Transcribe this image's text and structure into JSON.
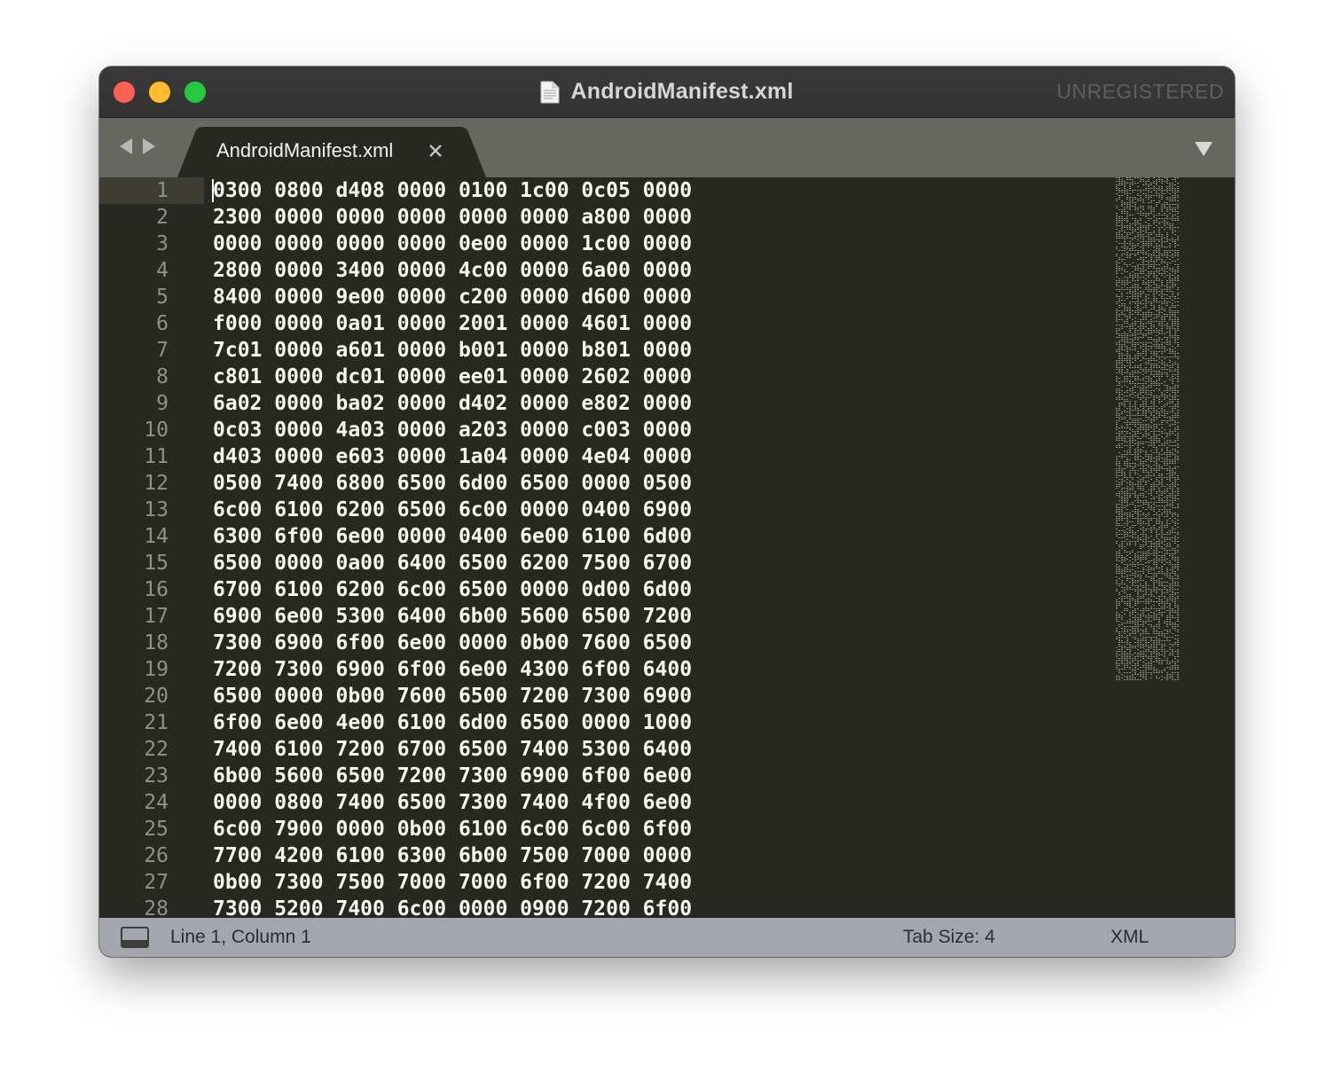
{
  "window": {
    "title": "AndroidManifest.xml",
    "unregistered_label": "UNREGISTERED"
  },
  "tabs": [
    {
      "label": "AndroidManifest.xml",
      "active": true
    }
  ],
  "icons": {
    "close": "close-icon",
    "document": "document-icon",
    "back": "arrow-left-icon",
    "forward": "arrow-right-icon",
    "dropdown": "dropdown-arrow-icon",
    "panel": "panel-icon"
  },
  "colors": {
    "editor_bg": "#272822",
    "text": "#f8f8f2",
    "gutter_text": "#90908a",
    "statusbar_bg": "#a4a6ad"
  },
  "editor": {
    "lines": [
      {
        "number": "1",
        "text": "0300 0800 d408 0000 0100 1c00 0c05 0000"
      },
      {
        "number": "2",
        "text": "2300 0000 0000 0000 0000 0000 a800 0000"
      },
      {
        "number": "3",
        "text": "0000 0000 0000 0000 0e00 0000 1c00 0000"
      },
      {
        "number": "4",
        "text": "2800 0000 3400 0000 4c00 0000 6a00 0000"
      },
      {
        "number": "5",
        "text": "8400 0000 9e00 0000 c200 0000 d600 0000"
      },
      {
        "number": "6",
        "text": "f000 0000 0a01 0000 2001 0000 4601 0000"
      },
      {
        "number": "7",
        "text": "7c01 0000 a601 0000 b001 0000 b801 0000"
      },
      {
        "number": "8",
        "text": "c801 0000 dc01 0000 ee01 0000 2602 0000"
      },
      {
        "number": "9",
        "text": "6a02 0000 ba02 0000 d402 0000 e802 0000"
      },
      {
        "number": "10",
        "text": "0c03 0000 4a03 0000 a203 0000 c003 0000"
      },
      {
        "number": "11",
        "text": "d403 0000 e603 0000 1a04 0000 4e04 0000"
      },
      {
        "number": "12",
        "text": "0500 7400 6800 6500 6d00 6500 0000 0500"
      },
      {
        "number": "13",
        "text": "6c00 6100 6200 6500 6c00 0000 0400 6900"
      },
      {
        "number": "14",
        "text": "6300 6f00 6e00 0000 0400 6e00 6100 6d00"
      },
      {
        "number": "15",
        "text": "6500 0000 0a00 6400 6500 6200 7500 6700"
      },
      {
        "number": "16",
        "text": "6700 6100 6200 6c00 6500 0000 0d00 6d00"
      },
      {
        "number": "17",
        "text": "6900 6e00 5300 6400 6b00 5600 6500 7200"
      },
      {
        "number": "18",
        "text": "7300 6900 6f00 6e00 0000 0b00 7600 6500"
      },
      {
        "number": "19",
        "text": "7200 7300 6900 6f00 6e00 4300 6f00 6400"
      },
      {
        "number": "20",
        "text": "6500 0000 0b00 7600 6500 7200 7300 6900"
      },
      {
        "number": "21",
        "text": "6f00 6e00 4e00 6100 6d00 6500 0000 1000"
      },
      {
        "number": "22",
        "text": "7400 6100 7200 6700 6500 7400 5300 6400"
      },
      {
        "number": "23",
        "text": "6b00 5600 6500 7200 7300 6900 6f00 6e00"
      },
      {
        "number": "24",
        "text": "0000 0800 7400 6500 7300 7400 4f00 6e00"
      },
      {
        "number": "25",
        "text": "6c00 7900 0000 0b00 6100 6c00 6c00 6f00"
      },
      {
        "number": "26",
        "text": "7700 4200 6100 6300 6b00 7500 7000 0000"
      },
      {
        "number": "27",
        "text": "0b00 7300 7500 7000 7000 6f00 7200 7400"
      },
      {
        "number": "28",
        "text": "7300 5200 7400 6c00 0000 0900 7200 6f00"
      }
    ]
  },
  "status_bar": {
    "position": "Line 1, Column 1",
    "tab_size": "Tab Size: 4",
    "syntax": "XML"
  }
}
